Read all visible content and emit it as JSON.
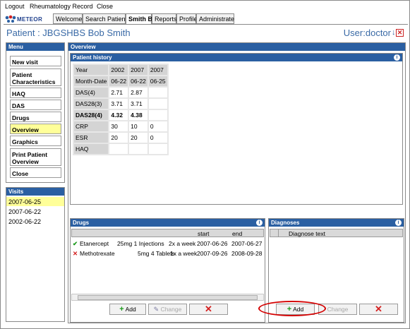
{
  "menubar": {
    "logout": "Logout",
    "record": "Rheumatology Record",
    "close": "Close"
  },
  "logo": {
    "text": "METEOR"
  },
  "tabs": [
    "Welcome",
    "Search Patient",
    "Smith B.",
    "Reports",
    "Profile",
    "Administrate"
  ],
  "patient_title": "Patient : JBGSHBS Bob Smith",
  "user_label": "User:doctor",
  "menu": {
    "title": "Menu",
    "items": [
      "New visit",
      "Patient Characteristics",
      "HAQ",
      "DAS",
      "Drugs",
      "Overview",
      "Graphics",
      "Print Patient Overview",
      "Close"
    ],
    "active": "Overview"
  },
  "visits": {
    "title": "Visits",
    "items": [
      "2007-06-25",
      "2007-06-22",
      "2002-06-22"
    ]
  },
  "overview_title": "Overview",
  "history": {
    "title": "Patient history",
    "rows": [
      [
        "Year",
        "2002",
        "2007",
        "2007"
      ],
      [
        "Month-Date",
        "06-22",
        "06-22",
        "06-25"
      ],
      [
        "DAS(4)",
        "2.71",
        "2.87",
        ""
      ],
      [
        "DAS28(3)",
        "3.71",
        "3.71",
        ""
      ],
      [
        "DAS28(4)",
        "4.32",
        "4.38",
        ""
      ],
      [
        "CRP",
        "30",
        "10",
        "0"
      ],
      [
        "ESR",
        "20",
        "20",
        "0"
      ],
      [
        "HAQ",
        "",
        "",
        ""
      ]
    ]
  },
  "drugs": {
    "title": "Drugs",
    "columns": {
      "start": "start",
      "end": "end"
    },
    "rows": [
      {
        "status": "active",
        "name": "Etanercept",
        "dose": "25mg 1 Injections",
        "freq": "2x a week",
        "start": "2007-06-26",
        "end": "2007-06-27"
      },
      {
        "status": "stopped",
        "name": "Methotrexate",
        "dose": "5mg   4 Tablets",
        "freq": "1x a week",
        "start": "2007-09-26",
        "end": "2008-09-28"
      }
    ],
    "buttons": {
      "add": "Add",
      "change": "Change",
      "remove": "Remove"
    }
  },
  "diagnoses": {
    "title": "Diagnoses",
    "column": "Diagnose text",
    "buttons": {
      "add": "Add",
      "change": "Change",
      "remove": "Remove"
    }
  },
  "colors": {
    "accent": "#2a5fa2",
    "highlight": "#ffff99",
    "annotation": "#d40000"
  }
}
